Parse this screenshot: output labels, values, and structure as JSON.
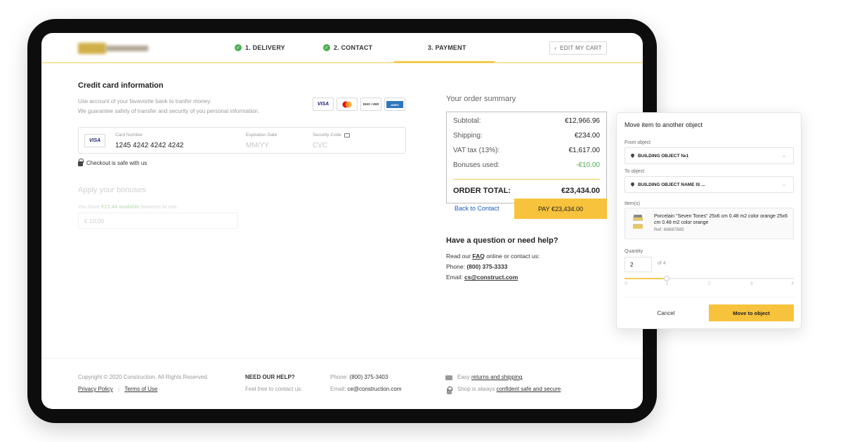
{
  "header": {
    "logo_alt": "CREDIT EASY",
    "steps": [
      {
        "label": "1. DELIVERY",
        "done": true
      },
      {
        "label": "2. CONTACT",
        "done": true
      },
      {
        "label": "3. PAYMENT",
        "done": false
      }
    ],
    "edit_cart": "EDIT MY CART"
  },
  "payment": {
    "title": "Credit card information",
    "desc_1": "Use account of your favavorite bank to tranfer money.",
    "desc_2": "We guarantee safety of transfer and security of you personal information.",
    "card_logos": [
      "VISA",
      "MASTERCARD",
      "DISCOVER",
      "AMERICAN EXPRESS"
    ],
    "card_badge": "VISA",
    "card_number_label": "Card Number",
    "card_number": "1245 4242 4242 4242",
    "expiry_label": "Expiration Date",
    "expiry_placeholder": "MM/YY",
    "security_label": "Security Code",
    "security_placeholder": "CVC",
    "safe_text": "Checkout is safe with us"
  },
  "bonuses": {
    "title": "Apply your bonuses",
    "text_before": "You have ",
    "amount": "€23.44 available",
    "text_after": " bonuses to use.",
    "input_value": "€  10.00"
  },
  "summary": {
    "title": "Your order summary",
    "rows": [
      {
        "label": "Subtotal:",
        "value": "€12,966.96"
      },
      {
        "label": "Shipping:",
        "value": "€234.00"
      },
      {
        "label": "VAT tax (13%):",
        "value": "€1,617.00"
      },
      {
        "label": "Bonuses used:",
        "value": "-€10.00"
      }
    ],
    "total_label": "ORDER TOTAL:",
    "total_value": "€23,434.00",
    "back_label": "Back to Contact",
    "pay_label": "PAY €23,434.00"
  },
  "help": {
    "title": "Have a question or need help?",
    "line1_a": "Read our ",
    "line1_link": "FAQ",
    "line1_b": " online or contact us:",
    "phone_label": "Phone: ",
    "phone": "(800) 375-3333",
    "email_label": "Email: ",
    "email": "cs@construct.com"
  },
  "footer": {
    "copyright": "Copyright © 2020 Construction. All Rights Reserved.",
    "privacy": "Privacy Policy",
    "separator": "|",
    "terms": "Terms of Use",
    "need_help": "NEED OUR HELP?",
    "contact": "Feel free to contact us:",
    "phone_label": "Phone: ",
    "phone": "(800) 375-3403",
    "email_label": "Email: ",
    "email": "ce@construction.com",
    "easy": "Easy ",
    "returns": "returns and shipping",
    "period": ".",
    "shop": "Shop is always ",
    "safe": "confident safe and secure",
    "period2": "."
  },
  "modal": {
    "title": "Move item to another object",
    "from_label": "From object",
    "from_value": "BUILDING OBJECT №1",
    "to_label": "To object",
    "to_value": "BUILDING OBJECT NAME IS ...",
    "items_label": "Item(s)",
    "item_name": "Porcelain \"Seven Tones\" 25x6 cm 0.48 m2 color orange 25x6 cm 0.48 m2 color orange",
    "item_ref": "Ref: 68687885",
    "quantity_label": "Quantity",
    "quantity_value": "2",
    "of_total": "of 4",
    "slider": {
      "min": 0,
      "max": 4,
      "value": 1,
      "ticks": [
        "0",
        "1",
        "2",
        "3",
        "4"
      ]
    },
    "cancel": "Cancel",
    "move": "Move to object"
  },
  "colors": {
    "accent": "#f8c33c",
    "success": "#4caf50",
    "link": "#1e5bc6"
  }
}
